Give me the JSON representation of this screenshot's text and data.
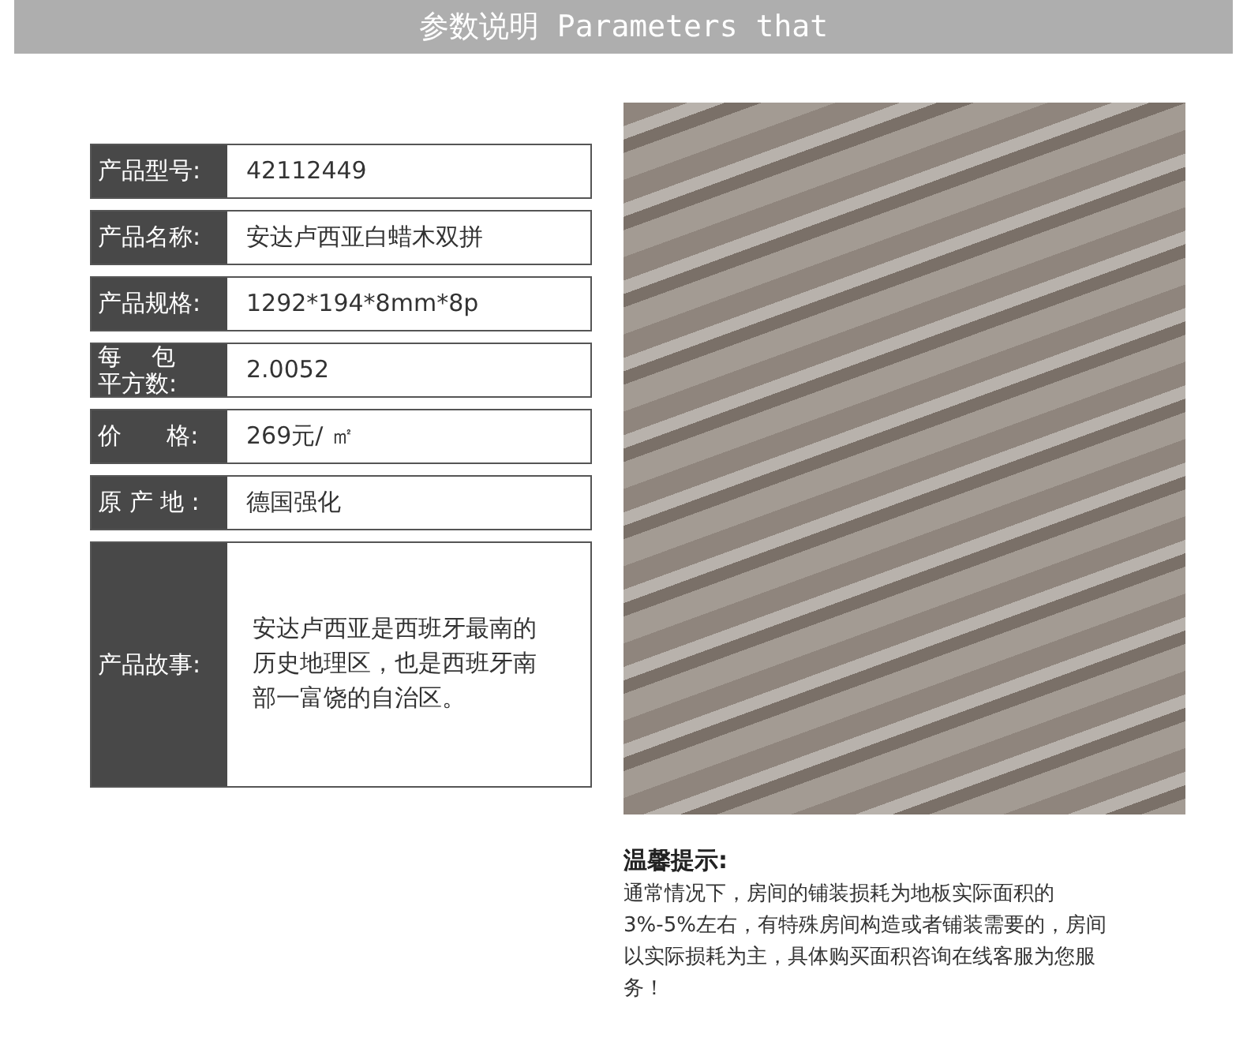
{
  "header": {
    "title": "参数说明 Parameters that"
  },
  "params": [
    {
      "label_lines": [
        "产品型号:"
      ],
      "value": "42112449"
    },
    {
      "label_lines": [
        "产品名称:"
      ],
      "value": "安达卢西亚白蜡木双拼"
    },
    {
      "label_lines": [
        "产品规格:"
      ],
      "value": "1292*194*8mm*8p"
    },
    {
      "label_lines": [
        "每    包",
        "平方数:"
      ],
      "value": "2.0052"
    },
    {
      "label_lines": [
        "价      格:"
      ],
      "value": "269元/ ㎡"
    },
    {
      "label_lines": [
        "原 产 地 :"
      ],
      "value": "德国强化"
    },
    {
      "label_lines": [
        "产品故事:"
      ],
      "value": "安达卢西亚是西班牙最南的历史地理区，也是西班牙南部一富饶的自治区。",
      "tall": true
    }
  ],
  "tips": {
    "title": "温馨提示:",
    "body": "通常情况下，房间的铺装损耗为地板实际面积的3%-5%左右，有特殊房间构造或者铺装需要的，房间以实际损耗为主，具体购买面积咨询在线客服为您服务！"
  }
}
